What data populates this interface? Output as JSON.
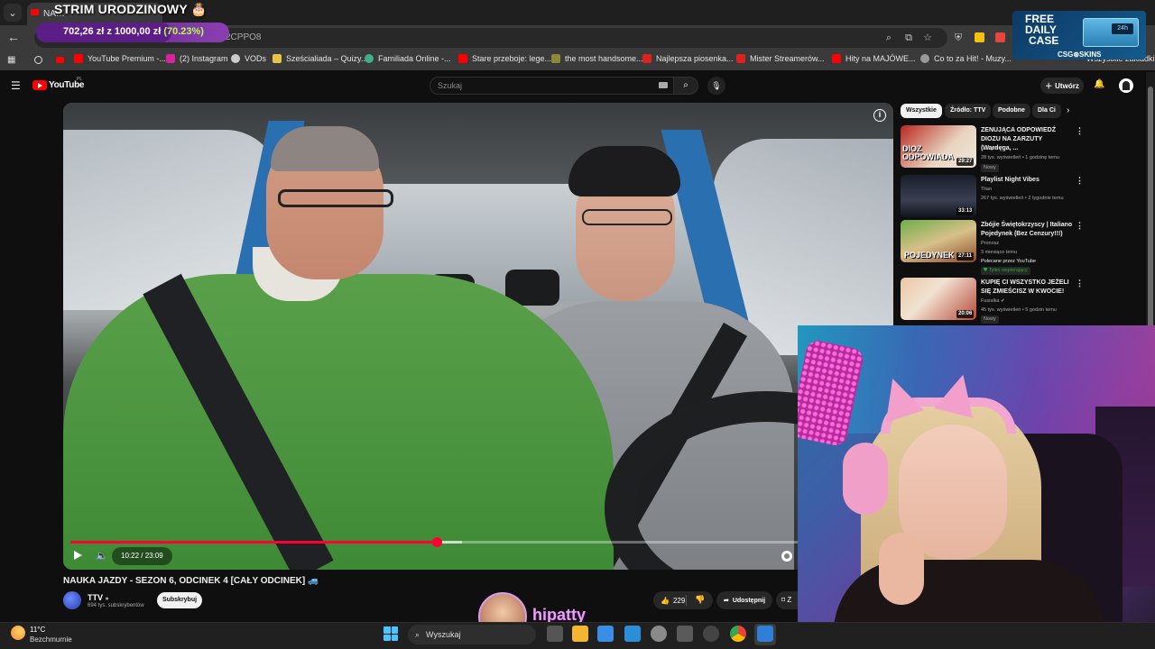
{
  "browser": {
    "active_tab_label": "NA…",
    "url_fragment": "2CPPO8",
    "bookmarks": [
      "YouTube Premium -...",
      "(2) Instagram",
      "VODs",
      "Sześcialiada – Quizy...",
      "Familiada Online -...",
      "Stare przeboje: lege...",
      "the most handsome...",
      "Najlepsza piosenka...",
      "Mister Streamerów...",
      "Hity na MAJÓWE...",
      "Co to za Hit! - Muzy...",
      "Wszystkie zakładki"
    ]
  },
  "overlay": {
    "title": "STRIM URODZINOWY 🎂",
    "goal_amount": "702,26 zł z 1000,00 zł",
    "goal_percent_text": "(70.23%)",
    "goal_fraction": 0.7023,
    "ad_line1": "FREE",
    "ad_line2": "DAILY",
    "ad_line3": "CASE",
    "ad_brand": "CSG⊛SKINS",
    "ad_badge": "24h"
  },
  "youtube": {
    "logo_text": "YouTube",
    "logo_region": "PL",
    "search_placeholder": "Szukaj",
    "create_label": "Utwórz",
    "video": {
      "title": "NAUKA JAZDY - SEZON 6, ODCINEK 4 [CAŁY ODCINEK] 🚙",
      "time": "10:22 / 23:09",
      "progress_fraction": 0.449,
      "channel": "TTV",
      "subscribers": "694 tys. subskrybentów",
      "subscribe_label": "Subskrybuj",
      "likes": "229",
      "share_label": "Udostępnij",
      "save_label": "Z"
    },
    "chips": [
      "Wszystkie",
      "Źródło: TTV",
      "Podobne",
      "Dla Ci"
    ],
    "recommendations": [
      {
        "title": "ZENUJĄCA ODPOWIEDŹ DIOZU NA ZARZUTY (Wardęga, ...",
        "channel": "Genger ✔",
        "meta": "28 tys. wyświetleń • 1 godzinę temu",
        "badge": "Nowy",
        "duration": "29:27",
        "thumb_text": "DIOZ ODPOWIADA"
      },
      {
        "title": "Playlist Night Vibes",
        "channel": "Titan",
        "meta": "267 tys. wyświetleń • 2 tygodnie temu",
        "badge": "",
        "duration": "33:13",
        "thumb_text": ""
      },
      {
        "title": "Zbójie Świętokrzyscy | Italiano Pojedynek (Bez Cenzury!!!)",
        "channel": "Pronosz",
        "meta": "3 miesiące temu",
        "extra": "Polecane przez YouTube",
        "badge": "Tylko wspierający",
        "duration": "27:11",
        "thumb_text": "POJEDYNEK"
      },
      {
        "title": "KUPIĘ CI WSZYSTKO JEŻELI SIĘ ZMIEŚCISZ W KWOCIE!",
        "channel": "Fusialka ✔",
        "meta": "45 tys. wyświetleń • 5 godzin temu",
        "badge": "Nowy",
        "duration": "20:06",
        "thumb_text": ""
      }
    ]
  },
  "streamer": {
    "name": "hipatty"
  },
  "taskbar": {
    "temperature": "11°C",
    "weather": "Bezchmurnie",
    "search_label": "Wyszukaj"
  },
  "colors": {
    "accent_red": "#ff0033",
    "goal_green": "#b6ff4a",
    "streamer_pink": "#e8a2f5"
  }
}
